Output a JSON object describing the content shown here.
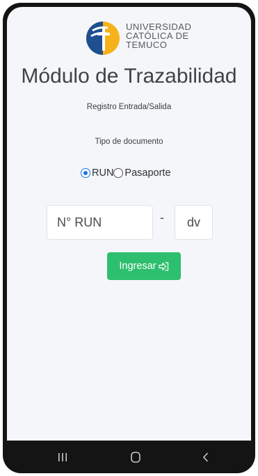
{
  "logo": {
    "line1": "UNIVERSIDAD",
    "line2": "CATÓLICA DE",
    "line3": "TEMUCO",
    "colors": {
      "blue": "#1d4f91",
      "yellow": "#f6b21b"
    }
  },
  "header": {
    "title": "Módulo de Trazabilidad",
    "subtitle": "Registro Entrada/Salida"
  },
  "form": {
    "doc_type_label": "Tipo de documento",
    "radio_options": [
      {
        "label": "RUN",
        "checked": true
      },
      {
        "label": "Pasaporte",
        "checked": false
      }
    ],
    "run_placeholder": "N° RUN",
    "separator": "-",
    "dv_placeholder": "dv",
    "submit_label": "Ingresar"
  },
  "colors": {
    "accent": "#2ebf6e",
    "radio": "#1a73e8",
    "background": "#f4f6f9"
  },
  "navigation": {
    "icons": [
      "recent-apps-icon",
      "home-icon",
      "back-icon"
    ]
  }
}
